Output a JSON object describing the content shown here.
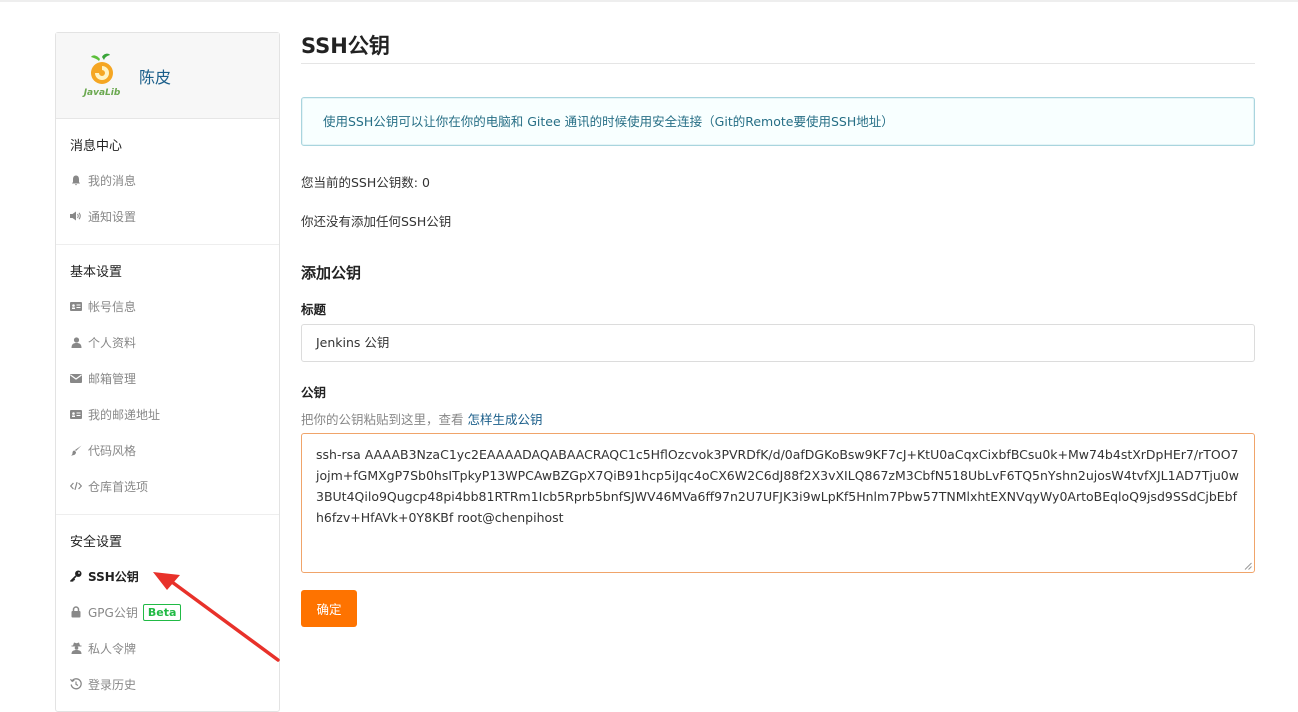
{
  "profile": {
    "name": "陈皮",
    "logo_text": "JavaLib"
  },
  "sidebar": {
    "sections": [
      {
        "title": "消息中心",
        "items": [
          {
            "label": "我的消息",
            "icon": "bell-icon"
          },
          {
            "label": "通知设置",
            "icon": "speaker-icon"
          }
        ]
      },
      {
        "title": "基本设置",
        "items": [
          {
            "label": "帐号信息",
            "icon": "id-card-icon"
          },
          {
            "label": "个人资料",
            "icon": "user-icon"
          },
          {
            "label": "邮箱管理",
            "icon": "mail-icon"
          },
          {
            "label": "我的邮递地址",
            "icon": "address-card-icon"
          },
          {
            "label": "代码风格",
            "icon": "brush-icon"
          },
          {
            "label": "仓库首选项",
            "icon": "code-icon"
          }
        ]
      },
      {
        "title": "安全设置",
        "items": [
          {
            "label": "SSH公钥",
            "icon": "key-icon",
            "active": true
          },
          {
            "label": "GPG公钥",
            "icon": "lock-icon",
            "badge": "Beta"
          },
          {
            "label": "私人令牌",
            "icon": "user-secret-icon"
          },
          {
            "label": "登录历史",
            "icon": "history-icon"
          }
        ]
      }
    ]
  },
  "main": {
    "title": "SSH公钥",
    "info": "使用SSH公钥可以让你在你的电脑和 Gitee 通讯的时候使用安全连接（Git的Remote要使用SSH地址）",
    "count_text": "您当前的SSH公钥数: 0",
    "empty_text": "你还没有添加任何SSH公钥",
    "add_heading": "添加公钥",
    "title_label": "标题",
    "title_value": "Jenkins 公钥",
    "key_label": "公钥",
    "hint_text": "把你的公钥粘贴到这里，查看 ",
    "hint_link": "怎样生成公钥",
    "key_value": "ssh-rsa AAAAB3NzaC1yc2EAAAADAQABAACRAQC1c5HflOzcvok3PVRDfK/d/0afDGKoBsw9KF7cJ+KtU0aCqxCixbfBCsu0k+Mw74b4stXrDpHEr7/rTOO7jojm+fGMXgP7Sb0hsITpkyP13WPCAwBZGpX7QiB91hcp5iJqc4oCX6W2C6dJ88f2X3vXILQ867zM3CbfN518UbLvF6TQ5nYshn2ujosW4tvfXJL1AD7Tju0w3BUt4Qilo9Qugcp48pi4bb81RTRm1Icb5Rprb5bnfSJWV46MVa6ff97n2U7UFJK3i9wLpKf5Hnlm7Pbw57TNMlxhtEXNVqyWy0ArtoBEqloQ9jsd9SSdCjbEbfh6fzv+HfAVk+0Y8KBf root@chenpihost",
    "submit_label": "确定"
  },
  "colors": {
    "accent": "#fe7300",
    "link": "#1a5e8a",
    "arrow": "#e8312a",
    "beta": "#21ba45"
  }
}
